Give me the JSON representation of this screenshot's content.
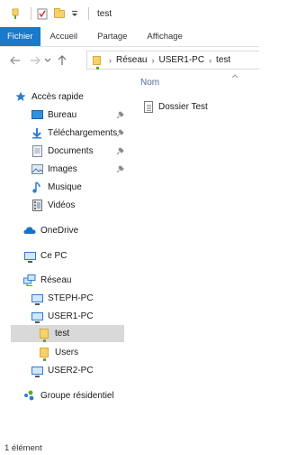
{
  "window": {
    "title": "test"
  },
  "quick_access_toolbar": {
    "properties_icon": "properties-icon",
    "folder_icon": "folder-icon",
    "dropdown_icon": "customize-dropdown-icon"
  },
  "ribbon": {
    "tabs": [
      {
        "label": "Fichier",
        "active": true
      },
      {
        "label": "Accueil"
      },
      {
        "label": "Partage"
      },
      {
        "label": "Affichage"
      }
    ]
  },
  "address": {
    "crumbs": [
      "Réseau",
      "USER1-PC",
      "test"
    ]
  },
  "sidebar": {
    "quick_access": {
      "label": "Accès rapide",
      "items": [
        {
          "label": "Bureau",
          "icon": "desktop-icon",
          "pinned": true
        },
        {
          "label": "Téléchargements",
          "icon": "download-icon",
          "pinned": true
        },
        {
          "label": "Documents",
          "icon": "documents-icon",
          "pinned": true
        },
        {
          "label": "Images",
          "icon": "images-icon",
          "pinned": true
        },
        {
          "label": "Musique",
          "icon": "music-icon",
          "pinned": false
        },
        {
          "label": "Vidéos",
          "icon": "videos-icon",
          "pinned": false
        }
      ]
    },
    "onedrive": {
      "label": "OneDrive"
    },
    "this_pc": {
      "label": "Ce PC"
    },
    "network": {
      "label": "Réseau",
      "items": [
        {
          "label": "STEPH-PC"
        },
        {
          "label": "USER1-PC"
        },
        {
          "label": "test",
          "selected": true
        },
        {
          "label": "Users"
        },
        {
          "label": "USER2-PC"
        }
      ]
    },
    "homegroup": {
      "label": "Groupe résidentiel"
    }
  },
  "content": {
    "column_header": "Nom",
    "files": [
      {
        "name": "Dossier Test",
        "icon": "document-icon"
      }
    ]
  },
  "status": {
    "item_count": "1 élément"
  },
  "colors": {
    "accent": "#1979ca",
    "selection": "#d9d9d9",
    "header_text": "#4c6d97"
  }
}
